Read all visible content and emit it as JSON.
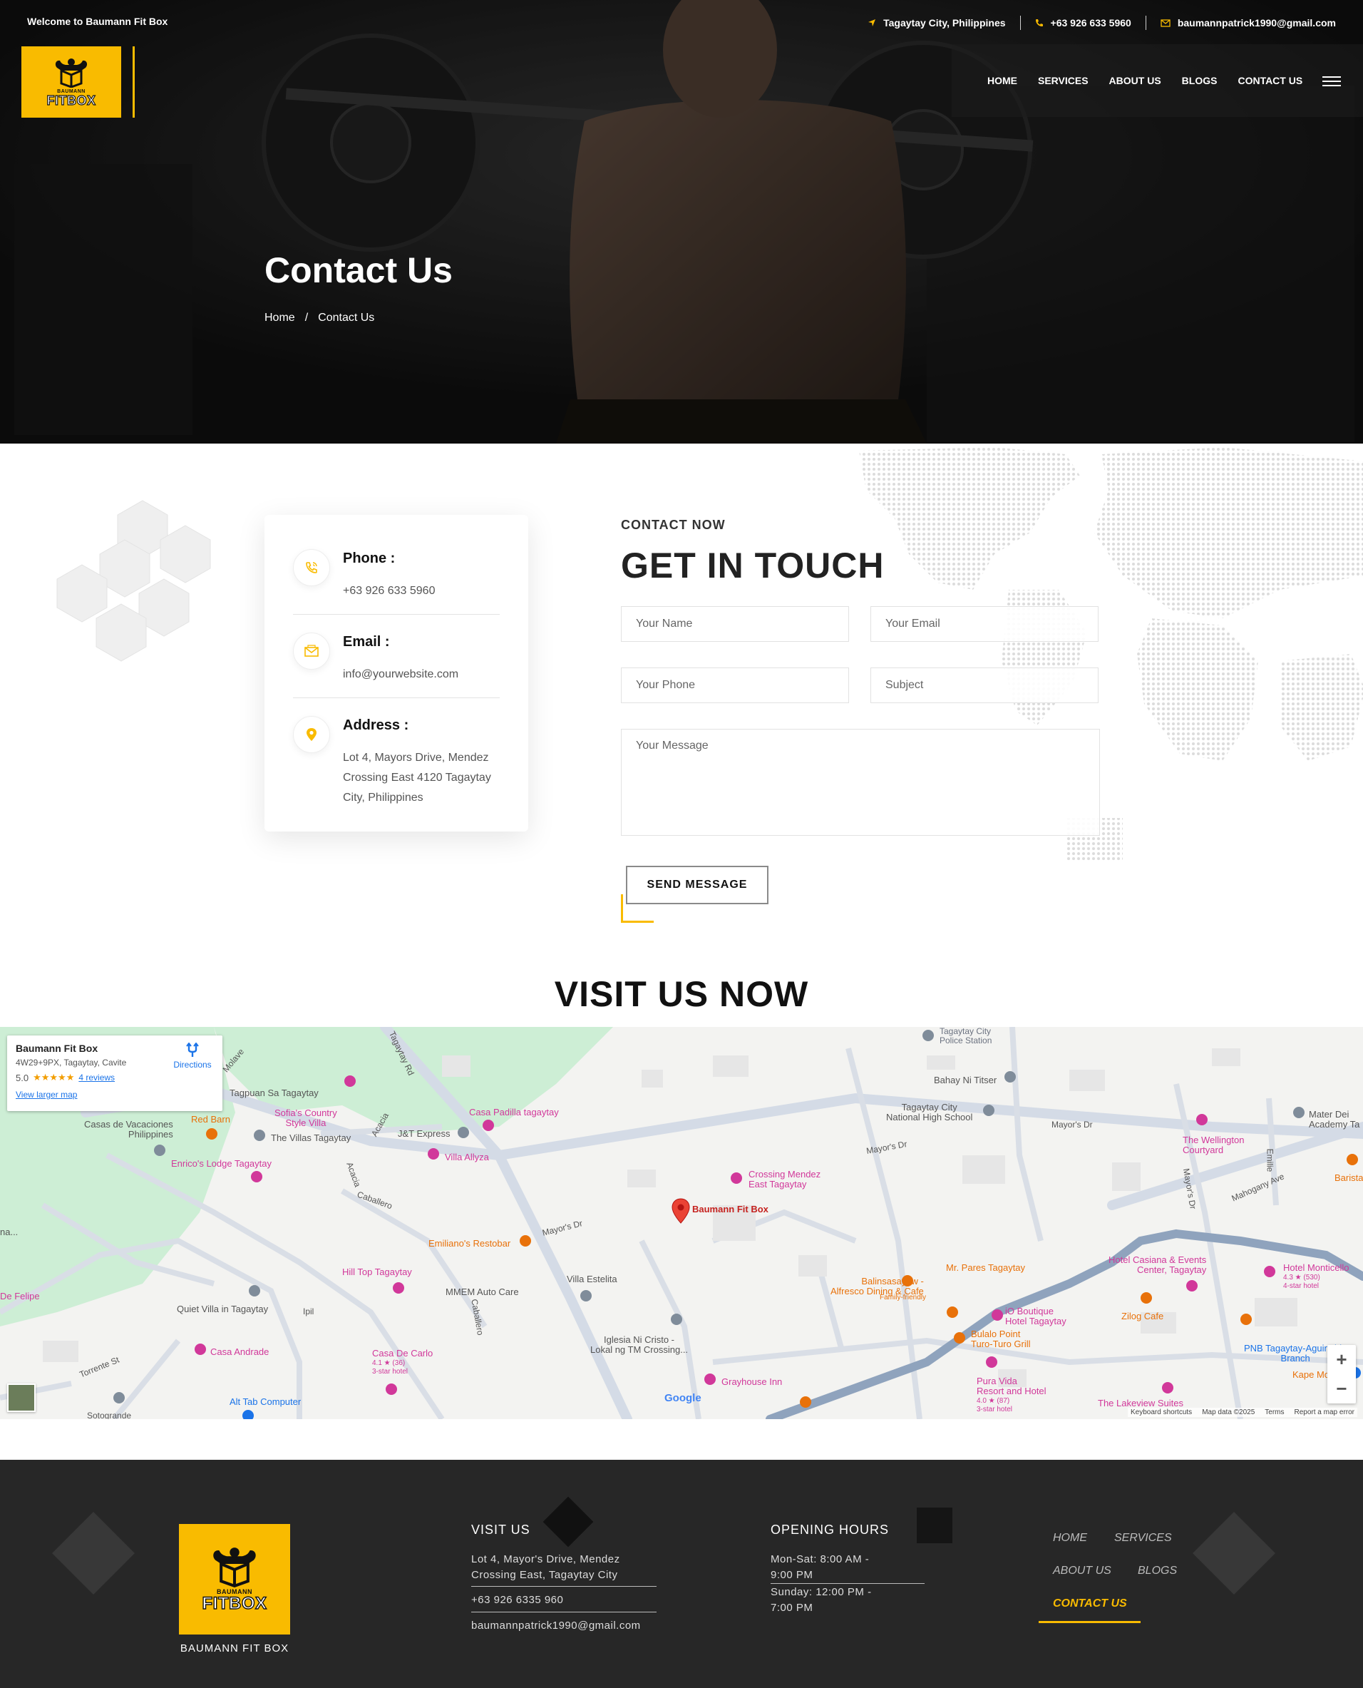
{
  "topbar": {
    "welcome": "Welcome to Baumann Fit Box",
    "location": "Tagaytay City, Philippines",
    "phone": "+63 926 633 5960",
    "email": "baumannpatrick1990@gmail.com"
  },
  "brand": {
    "small": "BAUMANN",
    "big": "FITBOX"
  },
  "nav": [
    {
      "label": "HOME"
    },
    {
      "label": "SERVICES"
    },
    {
      "label": "ABOUT US"
    },
    {
      "label": "BLOGS"
    },
    {
      "label": "CONTACT US"
    }
  ],
  "hero": {
    "title": "Contact Us",
    "breadcrumb": {
      "home": "Home",
      "separator": "/",
      "current": "Contact Us"
    }
  },
  "info": {
    "phone": {
      "label": "Phone :",
      "value": "+63 926 633 5960"
    },
    "email": {
      "label": "Email :",
      "value": "info@yourwebsite.com"
    },
    "address": {
      "label": "Address :",
      "value": "Lot 4, Mayors Drive, Mendez Crossing East 4120 Tagaytay City, Philippines"
    }
  },
  "form": {
    "pretitle": "CONTACT NOW",
    "title": "GET IN TOUCH",
    "name_placeholder": "Your Name",
    "email_placeholder": "Your Email",
    "phone_placeholder": "Your Phone",
    "subject_placeholder": "Subject",
    "message_placeholder": "Your Message",
    "submit": "SEND MESSAGE"
  },
  "visit": {
    "title": "VISIT US NOW"
  },
  "map": {
    "place": {
      "name": "Baumann Fit Box",
      "address": "4W29+9PX, Tagaytay, Cavite",
      "rating": "5.0",
      "stars": "★★★★★",
      "reviews": "4 reviews",
      "larger": "View larger map",
      "directions": "Directions"
    },
    "marker_label": "Baumann Fit Box",
    "labels": {
      "police": "Tagaytay City\nPolice Station",
      "bahay": "Bahay Ni Titser",
      "tagpuan": "Tagpuan Sa Tagaytay",
      "casa_padilla": "Casa Padilla tagaytay",
      "casas_vacaciones": "Casas de Vacaciones\nPhilippines",
      "red_barn": "Red Barn",
      "sofias": "Sofia's Country\nStyle Villa",
      "villas_tagaytay": "The Villas Tagaytay",
      "jt_express": "J&T Express",
      "villa_allyza": "Villa Allyza",
      "enricos": "Enrico's Lodge Tagaytay",
      "national_hs": "Tagaytay City\nNational High School",
      "mayors_dr_1": "Mayor's Dr",
      "mayors_dr_2": "Mayor's Dr",
      "mayors_dr_3": "Mayor's Dr",
      "mayors_dr_4": "Mayor's Dr",
      "wellington": "The Wellington\nCourtyard",
      "mater_dei": "Mater Dei\nAcademy Ta",
      "crossing_mendez": "Crossing Mendez\nEast Tagaytay",
      "emilianos": "Emiliano's Restobar",
      "mahogany": "Mahogany Ave",
      "barista": "Barista",
      "hill_top": "Hill Top Tagaytay",
      "villa_estelita": "Villa Estelita",
      "mmem": "MMEM Auto Care",
      "quiet_villa": "Quiet Villa in Tagaytay",
      "balinsasayaw": "Balinsasayaw -\nAlfresco Dining & Cafe",
      "family_friendly": "Family-friendly",
      "mr_pares": "Mr. Pares Tagaytay",
      "casiana": "Hotel Casiana & Events\nCenter, Tagaytay",
      "monticello": "Hotel Monticello",
      "monticello_rating": "4.3 ★ (530)",
      "monticello_class": "4-star hotel",
      "iglesia": "Iglesia Ni Cristo -\nLokal ng TM Crossing...",
      "io_boutique": "iO Boutique\nHotel Tagaytay",
      "zilog": "Zilog Cafe",
      "bulalo": "Bulalo Point\nTuro-Turo Grill",
      "pnb": "PNB Tagaytay-Aguinaldo\nBranch",
      "kape": "Kape Mo-To",
      "casa_andrade": "Casa Andrade",
      "casa_de_carlo": "Casa De Carlo",
      "carlo_rating": "4.1 ★ (36)",
      "carlo_class": "3-star hotel",
      "grayhouse": "Grayhouse Inn",
      "pura_vida": "Pura Vida\nResort and Hotel",
      "pura_rating": "4.0 ★ (87)",
      "pura_class": "3-star hotel",
      "lakeview": "The Lakeview Suites",
      "torrente": "Torrente St",
      "alt_tab": "Alt Tab Computer",
      "sotogrande": "Sotogrande",
      "tagaytay_rd": "Tagaytay Rd",
      "molave": "Molave",
      "acacia_1": "Acacia",
      "acacia_2": "Acacia",
      "caballero_1": "Caballero",
      "caballero_2": "Caballero",
      "emilie": "Emilie",
      "ipil": "Ipil",
      "de_felipe": "De Felipe",
      "na": "na..."
    },
    "footer": {
      "shortcuts": "Keyboard shortcuts",
      "data": "Map data ©2025",
      "terms": "Terms",
      "report": "Report a map error"
    },
    "google": "Google"
  },
  "footer": {
    "brand_name": "BAUMANN FIT BOX",
    "visit_title": "VISIT US",
    "address": "Lot 4, Mayor's Drive, Mendez Crossing East, Tagaytay City",
    "phone": "+63 926 6335 960",
    "email": "baumannpatrick1990@gmail.com",
    "hours_title": "OPENING HOURS",
    "weekday": "Mon-Sat: 8:00 AM - 9:00 PM",
    "sunday": "Sunday: 12:00 PM - 7:00 PM",
    "nav": [
      {
        "label": "HOME"
      },
      {
        "label": "SERVICES"
      },
      {
        "label": "ABOUT US"
      },
      {
        "label": "BLOGS"
      },
      {
        "label": "CONTACT US"
      }
    ]
  },
  "colors": {
    "accent": "#f9bb00",
    "dark": "#272727",
    "map_road": "#8fa3bd"
  }
}
